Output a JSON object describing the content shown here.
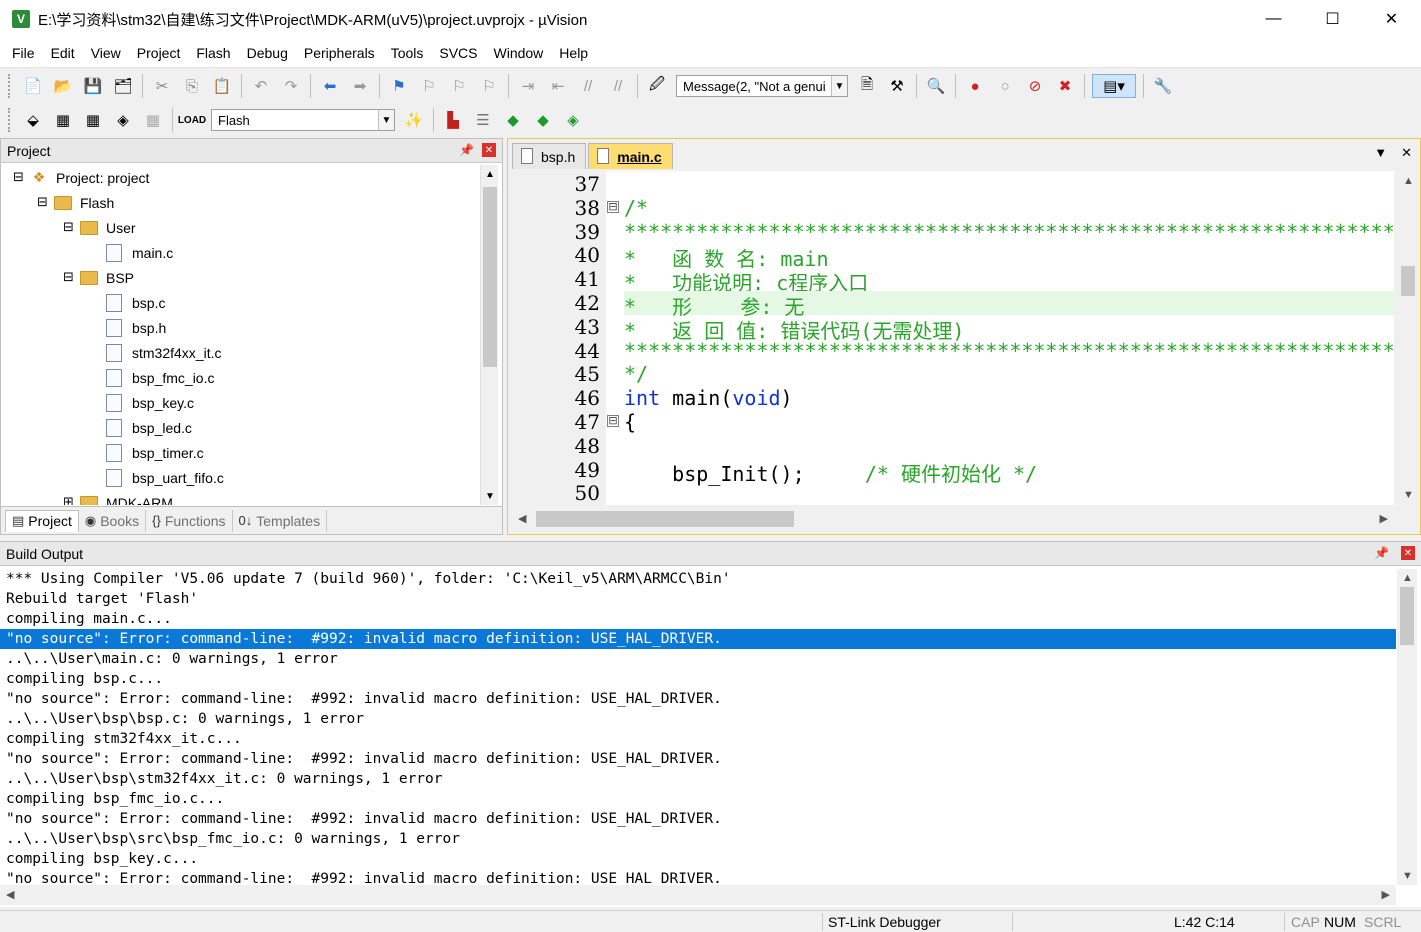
{
  "window": {
    "title": "E:\\学习资料\\stm32\\自建\\练习文件\\Project\\MDK-ARM(uV5)\\project.uvprojx - µVision",
    "app_icon": "keil-uvision-icon",
    "controls": [
      "—",
      "☐",
      "✕"
    ]
  },
  "menu": [
    "File",
    "Edit",
    "View",
    "Project",
    "Flash",
    "Debug",
    "Peripherals",
    "Tools",
    "SVCS",
    "Window",
    "Help"
  ],
  "toolbar": {
    "find_combo_value": "Message(2, \"Not a genui",
    "target_combo_value": "Flash"
  },
  "project_panel": {
    "title": "Project",
    "tree": [
      {
        "label": "Project: project",
        "level": 0,
        "type": "project",
        "expander": "⊟"
      },
      {
        "label": "Flash",
        "level": 1,
        "type": "target",
        "expander": "⊟"
      },
      {
        "label": "User",
        "level": 2,
        "type": "folder",
        "expander": "⊟"
      },
      {
        "label": "main.c",
        "level": 3,
        "type": "file"
      },
      {
        "label": "BSP",
        "level": 2,
        "type": "folder",
        "expander": "⊟"
      },
      {
        "label": "bsp.c",
        "level": 3,
        "type": "file"
      },
      {
        "label": "bsp.h",
        "level": 3,
        "type": "file"
      },
      {
        "label": "stm32f4xx_it.c",
        "level": 3,
        "type": "file"
      },
      {
        "label": "bsp_fmc_io.c",
        "level": 3,
        "type": "file"
      },
      {
        "label": "bsp_key.c",
        "level": 3,
        "type": "file"
      },
      {
        "label": "bsp_led.c",
        "level": 3,
        "type": "file"
      },
      {
        "label": "bsp_timer.c",
        "level": 3,
        "type": "file"
      },
      {
        "label": "bsp_uart_fifo.c",
        "level": 3,
        "type": "file"
      },
      {
        "label": "MDK-ARM",
        "level": 2,
        "type": "folder",
        "expander": "⊞"
      }
    ],
    "tabs": [
      {
        "label": "Project",
        "icon": "project-tab-icon",
        "glyph": "▤"
      },
      {
        "label": "Books",
        "icon": "books-tab-icon",
        "glyph": "◉"
      },
      {
        "label": "Functions",
        "icon": "functions-tab-icon",
        "glyph": "{}"
      },
      {
        "label": "Templates",
        "icon": "templates-tab-icon",
        "glyph": "0↓"
      }
    ]
  },
  "editor": {
    "tabs": [
      {
        "label": "bsp.h",
        "active": false
      },
      {
        "label": "main.c",
        "active": true
      }
    ],
    "lines": [
      {
        "num": "37",
        "fold": "",
        "segments": [
          {
            "t": "",
            "c": "plain"
          }
        ]
      },
      {
        "num": "38",
        "fold": "⊟",
        "segments": [
          {
            "t": "/*",
            "c": "comment"
          }
        ]
      },
      {
        "num": "39",
        "fold": "",
        "segments": [
          {
            "t": "*********************************************************************************************************",
            "c": "comment"
          }
        ]
      },
      {
        "num": "40",
        "fold": "",
        "segments": [
          {
            "t": "*   函 数 名: main",
            "c": "comment"
          }
        ]
      },
      {
        "num": "41",
        "fold": "",
        "segments": [
          {
            "t": "*   功能说明: c程序入口",
            "c": "comment"
          }
        ]
      },
      {
        "num": "42",
        "fold": "",
        "highlight": true,
        "segments": [
          {
            "t": "*   形    参: 无",
            "c": "comment"
          }
        ]
      },
      {
        "num": "43",
        "fold": "",
        "segments": [
          {
            "t": "*   返 回 值: 错误代码(无需处理)",
            "c": "comment"
          }
        ]
      },
      {
        "num": "44",
        "fold": "",
        "segments": [
          {
            "t": "*********************************************************************************************************",
            "c": "comment"
          }
        ]
      },
      {
        "num": "45",
        "fold": "",
        "segments": [
          {
            "t": "*/",
            "c": "comment"
          }
        ]
      },
      {
        "num": "46",
        "fold": "",
        "segments": [
          {
            "t": "int",
            "c": "kw"
          },
          {
            "t": " main(",
            "c": "plain"
          },
          {
            "t": "void",
            "c": "kw"
          },
          {
            "t": ")",
            "c": "plain"
          }
        ]
      },
      {
        "num": "47",
        "fold": "⊟",
        "segments": [
          {
            "t": "{",
            "c": "plain"
          }
        ]
      },
      {
        "num": "48",
        "fold": "",
        "segments": [
          {
            "t": "",
            "c": "plain"
          }
        ]
      },
      {
        "num": "49",
        "fold": "",
        "segments": [
          {
            "t": "    bsp_Init();     ",
            "c": "plain"
          },
          {
            "t": "/* 硬件初始化 */",
            "c": "comment"
          }
        ]
      },
      {
        "num": "50",
        "fold": "",
        "segments": [
          {
            "t": "",
            "c": "plain"
          }
        ]
      }
    ]
  },
  "build_output": {
    "title": "Build Output",
    "lines": [
      {
        "text": "*** Using Compiler 'V5.06 update 7 (build 960)', folder: 'C:\\Keil_v5\\ARM\\ARMCC\\Bin'",
        "selected": false
      },
      {
        "text": "Rebuild target 'Flash'",
        "selected": false
      },
      {
        "text": "compiling main.c...",
        "selected": false
      },
      {
        "text": "\"no source\": Error: command-line:  #992: invalid macro definition: USE_HAL_DRIVER.",
        "selected": true
      },
      {
        "text": "..\\..\\User\\main.c: 0 warnings, 1 error",
        "selected": false
      },
      {
        "text": "compiling bsp.c...",
        "selected": false
      },
      {
        "text": "\"no source\": Error: command-line:  #992: invalid macro definition: USE_HAL_DRIVER.",
        "selected": false
      },
      {
        "text": "..\\..\\User\\bsp\\bsp.c: 0 warnings, 1 error",
        "selected": false
      },
      {
        "text": "compiling stm32f4xx_it.c...",
        "selected": false
      },
      {
        "text": "\"no source\": Error: command-line:  #992: invalid macro definition: USE_HAL_DRIVER.",
        "selected": false
      },
      {
        "text": "..\\..\\User\\bsp\\stm32f4xx_it.c: 0 warnings, 1 error",
        "selected": false
      },
      {
        "text": "compiling bsp_fmc_io.c...",
        "selected": false
      },
      {
        "text": "\"no source\": Error: command-line:  #992: invalid macro definition: USE_HAL_DRIVER.",
        "selected": false
      },
      {
        "text": "..\\..\\User\\bsp\\src\\bsp_fmc_io.c: 0 warnings, 1 error",
        "selected": false
      },
      {
        "text": "compiling bsp_key.c...",
        "selected": false
      },
      {
        "text": "\"no source\": Error: command-line:  #992: invalid macro definition: USE_HAL_DRIVER.",
        "selected": false
      }
    ]
  },
  "status_bar": {
    "debugger": "ST-Link Debugger",
    "position": "L:42 C:14",
    "cap": "CAP",
    "num": "NUM",
    "scrl": "SCRL"
  },
  "colors": {
    "comment": "#2aa52a",
    "keyword": "#1030d8",
    "selection": "#0a78d7",
    "active_tab": "#fddc72",
    "current_line": "#e4f8e4"
  }
}
